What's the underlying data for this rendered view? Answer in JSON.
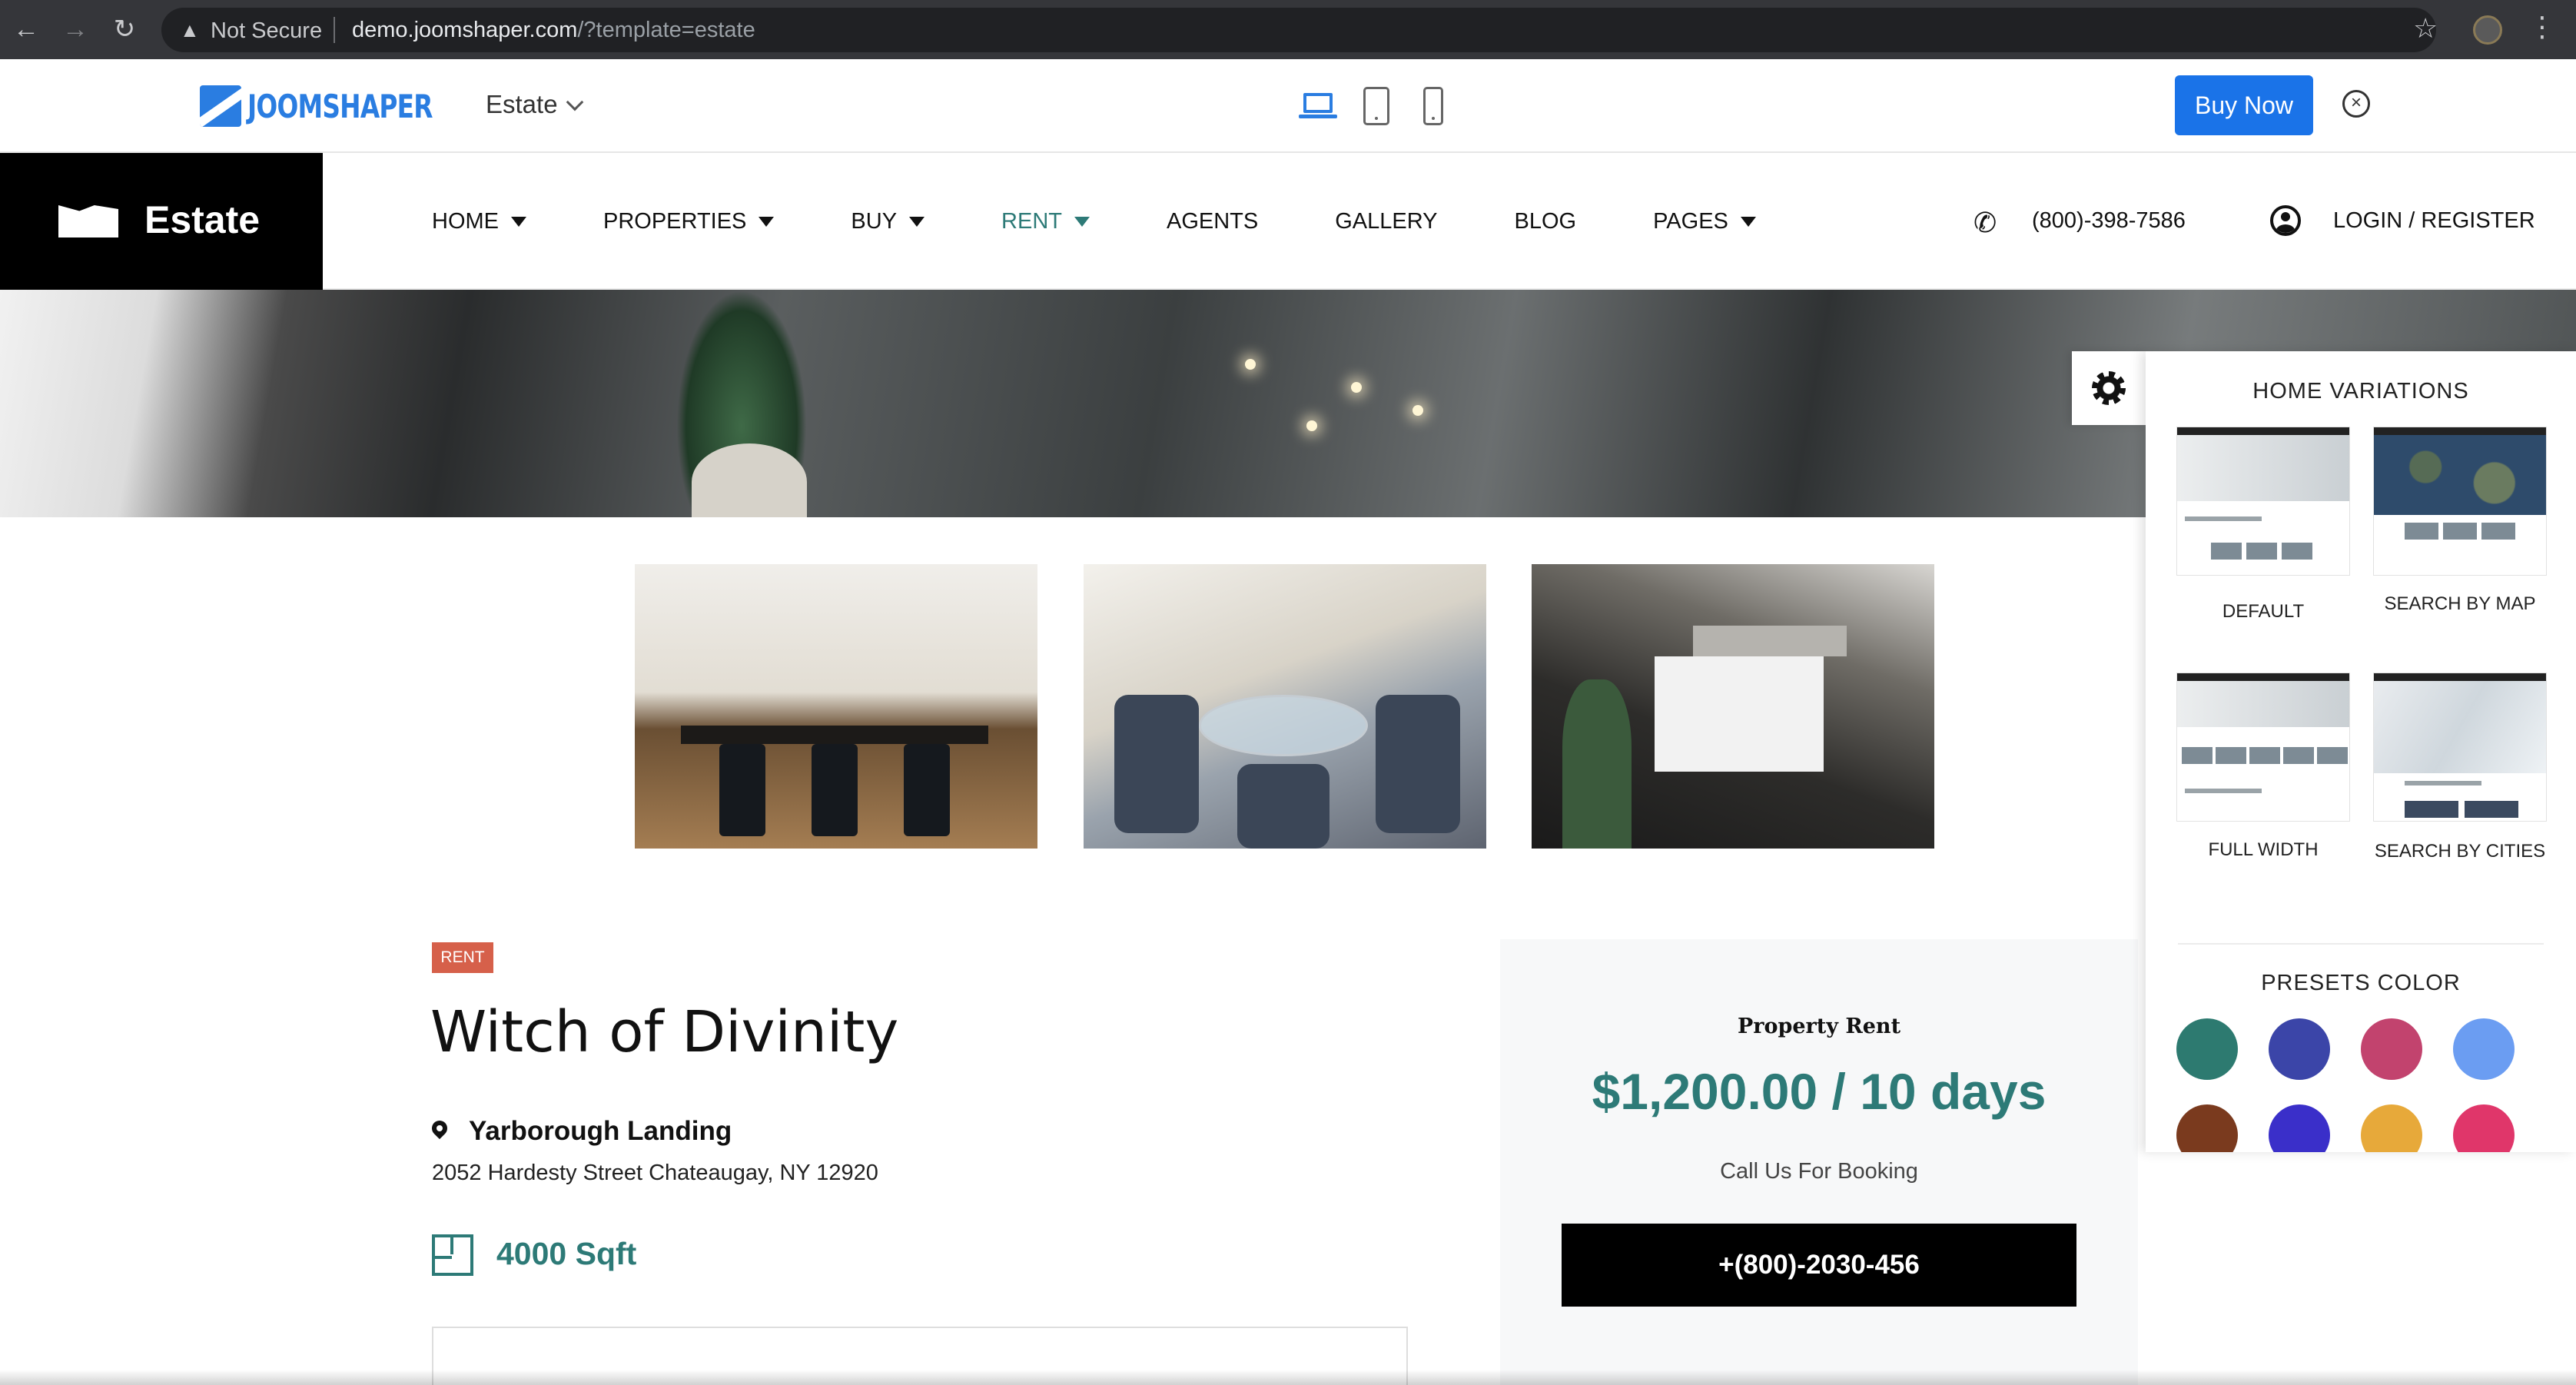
{
  "browser": {
    "security_label": "Not Secure",
    "url_host": "demo.joomshaper.com",
    "url_path": "/?template=estate"
  },
  "demo_bar": {
    "brand": "JOOMSHAPER",
    "template_select": "Estate",
    "buy_label": "Buy Now",
    "devices": [
      "laptop-icon",
      "tablet-icon",
      "phone-icon"
    ],
    "accent": "#1a73e8"
  },
  "header": {
    "site_name": "Estate",
    "nav": [
      {
        "label": "HOME",
        "has_caret": true,
        "active": false
      },
      {
        "label": "PROPERTIES",
        "has_caret": true,
        "active": false
      },
      {
        "label": "BUY",
        "has_caret": true,
        "active": false
      },
      {
        "label": "RENT",
        "has_caret": true,
        "active": true
      },
      {
        "label": "AGENTS",
        "has_caret": false,
        "active": false
      },
      {
        "label": "GALLERY",
        "has_caret": false,
        "active": false
      },
      {
        "label": "BLOG",
        "has_caret": false,
        "active": false
      },
      {
        "label": "PAGES",
        "has_caret": true,
        "active": false
      }
    ],
    "phone": "(800)-398-7586",
    "login": "LOGIN / REGISTER"
  },
  "property": {
    "badge": "RENT",
    "title": "Witch of Divinity",
    "location": "Yarborough Landing",
    "address": "2052 Hardesty Street Chateaugay, NY 12920",
    "area": "4000 Sqft",
    "accent": "#2d7a77"
  },
  "rent_card": {
    "label": "Property Rent",
    "price": "$1,200.00 / 10 days",
    "call_text": "Call Us For Booking",
    "phone_button": "+(800)-2030-456"
  },
  "panel": {
    "heading": "HOME VARIATIONS",
    "variations": [
      {
        "label": "DEFAULT"
      },
      {
        "label": "SEARCH BY MAP"
      },
      {
        "label": "FULL WIDTH"
      },
      {
        "label": "SEARCH BY CITIES"
      }
    ],
    "presets_heading": "PRESETS COLOR",
    "preset_colors": [
      "#2d7a70",
      "#3b45a8",
      "#c2436e",
      "#6b9df2",
      "#7a3a1e",
      "#3a2fc9",
      "#e7a93a",
      "#e0366a"
    ]
  }
}
